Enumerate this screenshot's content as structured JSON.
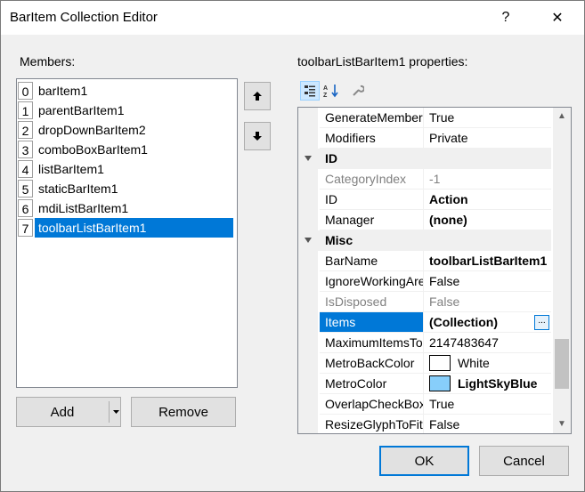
{
  "window": {
    "title": "BarItem Collection Editor",
    "help_label": "?",
    "close_label": "✕"
  },
  "members": {
    "label": "Members:",
    "items": [
      {
        "index": "0",
        "name": "barItem1"
      },
      {
        "index": "1",
        "name": "parentBarItem1"
      },
      {
        "index": "2",
        "name": "dropDownBarItem2"
      },
      {
        "index": "3",
        "name": "comboBoxBarItem1"
      },
      {
        "index": "4",
        "name": "listBarItem1"
      },
      {
        "index": "5",
        "name": "staticBarItem1"
      },
      {
        "index": "6",
        "name": "mdiListBarItem1"
      },
      {
        "index": "7",
        "name": "toolbarListBarItem1"
      }
    ],
    "selected_index": 7
  },
  "move_buttons": {
    "up_icon": "arrow-up-icon",
    "down_icon": "arrow-down-icon"
  },
  "buttons": {
    "add": "Add",
    "remove": "Remove",
    "ok": "OK",
    "cancel": "Cancel"
  },
  "properties": {
    "label": "toolbarListBarItem1 properties:",
    "toolbar_icons": [
      "categorized-icon",
      "alphabetical-icon",
      "property-pages-icon"
    ],
    "rows": [
      {
        "name": "GenerateMember",
        "value": "True"
      },
      {
        "name": "Modifiers",
        "value": "Private"
      },
      {
        "category": "ID"
      },
      {
        "name": "CategoryIndex",
        "value": "-1",
        "dim": true
      },
      {
        "name": "ID",
        "value": "Action",
        "bold": true
      },
      {
        "name": "Manager",
        "value": "(none)",
        "bold": true
      },
      {
        "category": "Misc"
      },
      {
        "name": "BarName",
        "value": "toolbarListBarItem1",
        "bold": true
      },
      {
        "name": "IgnoreWorkingArea",
        "value": "False"
      },
      {
        "name": "IsDisposed",
        "value": "False",
        "dim": true
      },
      {
        "name": "Items",
        "value": "(Collection)",
        "bold": true,
        "selected": true,
        "ellipsis": "..."
      },
      {
        "name": "MaximumItemsToShow",
        "value": "2147483647"
      },
      {
        "name": "MetroBackColor",
        "value": "White",
        "swatch": "#ffffff"
      },
      {
        "name": "MetroColor",
        "value": "LightSkyBlue",
        "bold": true,
        "swatch": "#87cefa"
      },
      {
        "name": "OverlapCheckBox",
        "value": "True"
      },
      {
        "name": "ResizeGlyphToFit",
        "value": "False"
      }
    ]
  },
  "colors": {
    "selection": "#0078d7",
    "accent_border": "#0078d7"
  }
}
